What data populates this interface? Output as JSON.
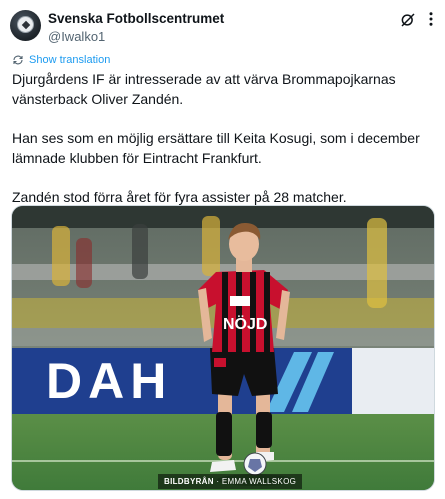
{
  "author": {
    "display_name": "Svenska Fotbollscentrumet",
    "handle": "@Iwalko1",
    "avatar_icon": "football-avatar-icon"
  },
  "actions": {
    "grok_icon": "grok-icon",
    "more_icon": "more-options-icon"
  },
  "translate": {
    "label": "Show translation",
    "icon": "translate-icon"
  },
  "tweet": {
    "line1": "Djurgårdens IF är intresserade av att värva Brommapojkarnas",
    "line2": "vänsterback Oliver Zandén.",
    "line3": "Han ses som en möjlig ersättare till Keita Kosugi, som i december",
    "line4": "lämnade klubben för Eintracht Frankfurt.",
    "line5": "Zandén stod förra året för fyra assister på 28 matcher."
  },
  "media": {
    "ad_board_text": "DAH",
    "shirt_sponsor": "NÖJD",
    "watermark_brand": "BILDBYRÅN",
    "watermark_credit": "EMMA WALLSKOG"
  },
  "colors": {
    "link": "#1d9bf0",
    "text": "#0f1419",
    "secondary": "#536471",
    "pitch": "#3f7a3a",
    "board_blue": "#1f3f8f",
    "shirt_red": "#c8102e"
  }
}
